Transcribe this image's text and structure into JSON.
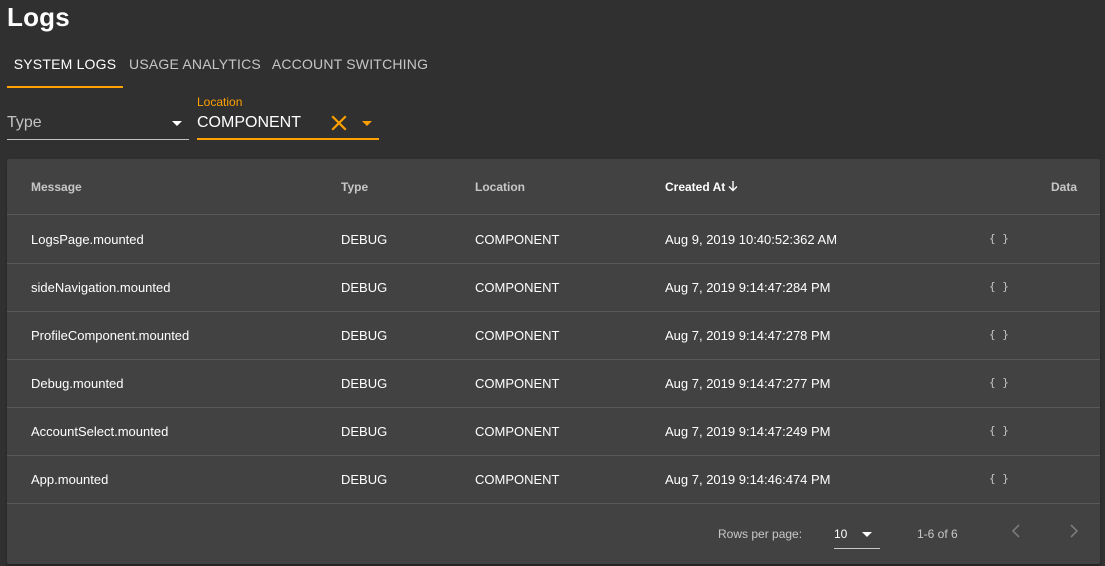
{
  "page": {
    "title": "Logs"
  },
  "tabs": [
    {
      "label": "SYSTEM LOGS",
      "active": true
    },
    {
      "label": "USAGE ANALYTICS",
      "active": false
    },
    {
      "label": "ACCOUNT SWITCHING",
      "active": false
    }
  ],
  "filters": {
    "type": {
      "placeholder": "Type",
      "value": ""
    },
    "location": {
      "label": "Location",
      "value": "COMPONENT"
    }
  },
  "table": {
    "headers": {
      "message": "Message",
      "type": "Type",
      "location": "Location",
      "created_at": "Created At",
      "data": "Data"
    },
    "sort": {
      "column": "created_at",
      "direction": "desc"
    },
    "rows": [
      {
        "message": "LogsPage.mounted",
        "type": "DEBUG",
        "location": "COMPONENT",
        "created_at": "Aug 9, 2019 10:40:52:362 AM",
        "data": "{ }"
      },
      {
        "message": "sideNavigation.mounted",
        "type": "DEBUG",
        "location": "COMPONENT",
        "created_at": "Aug 7, 2019 9:14:47:284 PM",
        "data": "{ }"
      },
      {
        "message": "ProfileComponent.mounted",
        "type": "DEBUG",
        "location": "COMPONENT",
        "created_at": "Aug 7, 2019 9:14:47:278 PM",
        "data": "{ }"
      },
      {
        "message": "Debug.mounted",
        "type": "DEBUG",
        "location": "COMPONENT",
        "created_at": "Aug 7, 2019 9:14:47:277 PM",
        "data": "{ }"
      },
      {
        "message": "AccountSelect.mounted",
        "type": "DEBUG",
        "location": "COMPONENT",
        "created_at": "Aug 7, 2019 9:14:47:249 PM",
        "data": "{ }"
      },
      {
        "message": "App.mounted",
        "type": "DEBUG",
        "location": "COMPONENT",
        "created_at": "Aug 7, 2019 9:14:46:474 PM",
        "data": "{ }"
      }
    ]
  },
  "pagination": {
    "rows_per_page_label": "Rows per page:",
    "rows_per_page": "10",
    "range": "1-6 of 6"
  },
  "colors": {
    "accent": "#ffa000",
    "background": "#303030",
    "card": "#424242"
  }
}
